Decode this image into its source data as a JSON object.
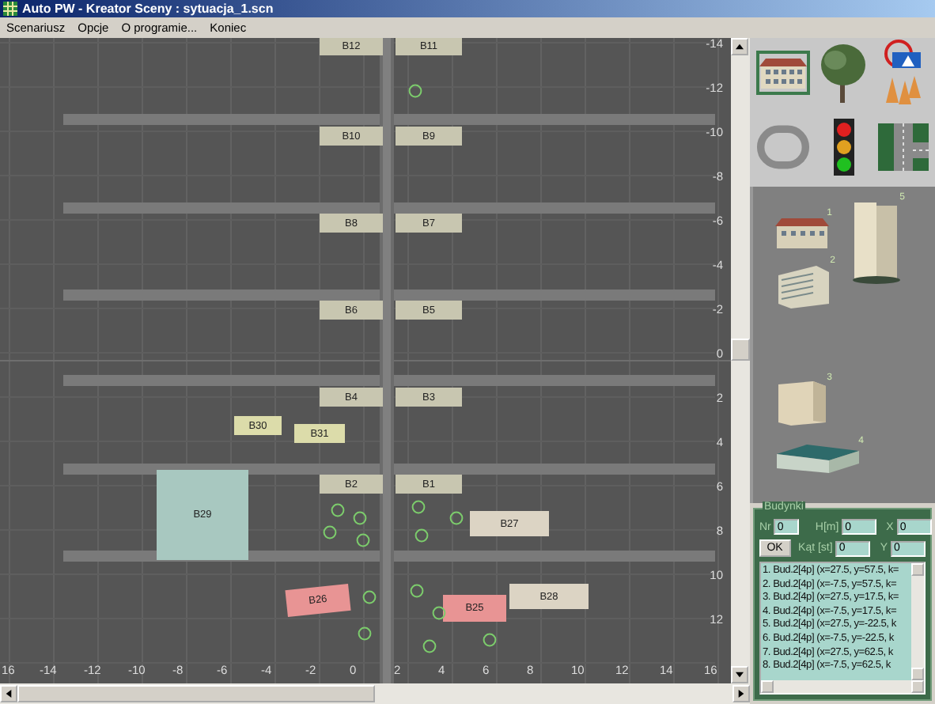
{
  "window": {
    "title": "Auto PW - Kreator Sceny : sytuacja_1.scn"
  },
  "menu": [
    "Scenariusz",
    "Opcje",
    "O programie...",
    "Koniec"
  ],
  "map": {
    "x_ticks": [
      "16",
      "-14",
      "-12",
      "-10",
      "-8",
      "-6",
      "-4",
      "-2",
      "0",
      "2",
      "4",
      "6",
      "8",
      "10",
      "12",
      "14",
      "16"
    ],
    "y_ticks": [
      "-14",
      "-12",
      "-10",
      "-8",
      "-6",
      "-4",
      "-2",
      "0",
      "2",
      "4",
      "6",
      "8",
      "10",
      "12"
    ],
    "buildings": [
      {
        "label": "B12",
        "color": "#c8c6b0"
      },
      {
        "label": "B11",
        "color": "#c8c6b0"
      },
      {
        "label": "B10",
        "color": "#c8c6b0"
      },
      {
        "label": "B9",
        "color": "#c8c6b0"
      },
      {
        "label": "B8",
        "color": "#c8c6b0"
      },
      {
        "label": "B7",
        "color": "#c8c6b0"
      },
      {
        "label": "B6",
        "color": "#c8c6b0"
      },
      {
        "label": "B5",
        "color": "#c8c6b0"
      },
      {
        "label": "B4",
        "color": "#c8c6b0"
      },
      {
        "label": "B3",
        "color": "#c8c6b0"
      },
      {
        "label": "B2",
        "color": "#c8c6b0"
      },
      {
        "label": "B1",
        "color": "#c8c6b0"
      },
      {
        "label": "B30",
        "color": "#dcdcaa"
      },
      {
        "label": "B31",
        "color": "#dcdcaa"
      },
      {
        "label": "B29",
        "color": "#a8c8c0"
      },
      {
        "label": "B27",
        "color": "#dcd4c4"
      },
      {
        "label": "B28",
        "color": "#dcd4c4"
      },
      {
        "label": "B26",
        "color": "#e89494"
      },
      {
        "label": "B25",
        "color": "#e89494"
      }
    ]
  },
  "tools": [
    {
      "kind": "building",
      "selected": true
    },
    {
      "kind": "tree",
      "selected": false
    },
    {
      "kind": "sign",
      "selected": false
    },
    {
      "kind": "cones",
      "selected": false
    },
    {
      "kind": "track",
      "selected": false
    },
    {
      "kind": "light",
      "selected": false
    },
    {
      "kind": "crossing",
      "selected": false
    }
  ],
  "palette": [
    {
      "number": "1",
      "kind": "house"
    },
    {
      "number": "5",
      "kind": "tower"
    },
    {
      "number": "2",
      "kind": "block"
    },
    {
      "number": "3",
      "kind": "slab"
    },
    {
      "number": "4",
      "kind": "hall"
    }
  ],
  "buildings_panel": {
    "title": "Budynki",
    "ok_button": "OK",
    "fields": [
      {
        "label": "Nr",
        "value": "0"
      },
      {
        "label": "H[m]",
        "value": "0"
      },
      {
        "label": "X",
        "value": "0"
      },
      {
        "label": "Kąt [st]",
        "value": "0"
      },
      {
        "label": "Y",
        "value": "0"
      }
    ],
    "list": [
      "1. Bud.2[4p] (x=27.5, y=57.5, k=",
      "2. Bud.2[4p] (x=-7.5, y=57.5, k=",
      "3. Bud.2[4p] (x=27.5, y=17.5, k=",
      "4. Bud.2[4p] (x=-7.5, y=17.5, k=",
      "5. Bud.2[4p] (x=27.5, y=-22.5, k",
      "6. Bud.2[4p] (x=-7.5, y=-22.5, k",
      "7. Bud.2[4p] (x=27.5, y=62.5, k",
      "8. Bud.2[4p] (x=-7.5, y=62.5, k"
    ]
  }
}
